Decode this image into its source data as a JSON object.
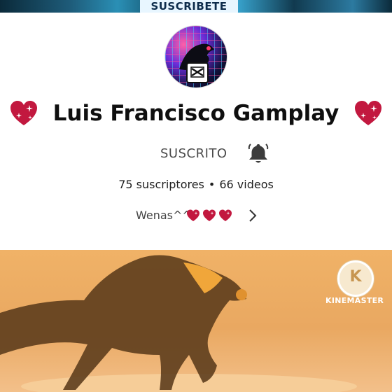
{
  "banner": {
    "text": "SUSCRIBETE"
  },
  "channel": {
    "name": "Luis Francisco Gamplay"
  },
  "subscription": {
    "status_label": "SUSCRITO"
  },
  "stats": {
    "subscribers": "75 suscriptores",
    "separator": "•",
    "videos": "66 videos"
  },
  "description": {
    "text": "Wenas^^"
  },
  "video": {
    "watermark": "KINEMASTER",
    "watermark_logo_letter": "K"
  },
  "colors": {
    "heart": "#c2183f",
    "video_bg": "#efb064"
  }
}
